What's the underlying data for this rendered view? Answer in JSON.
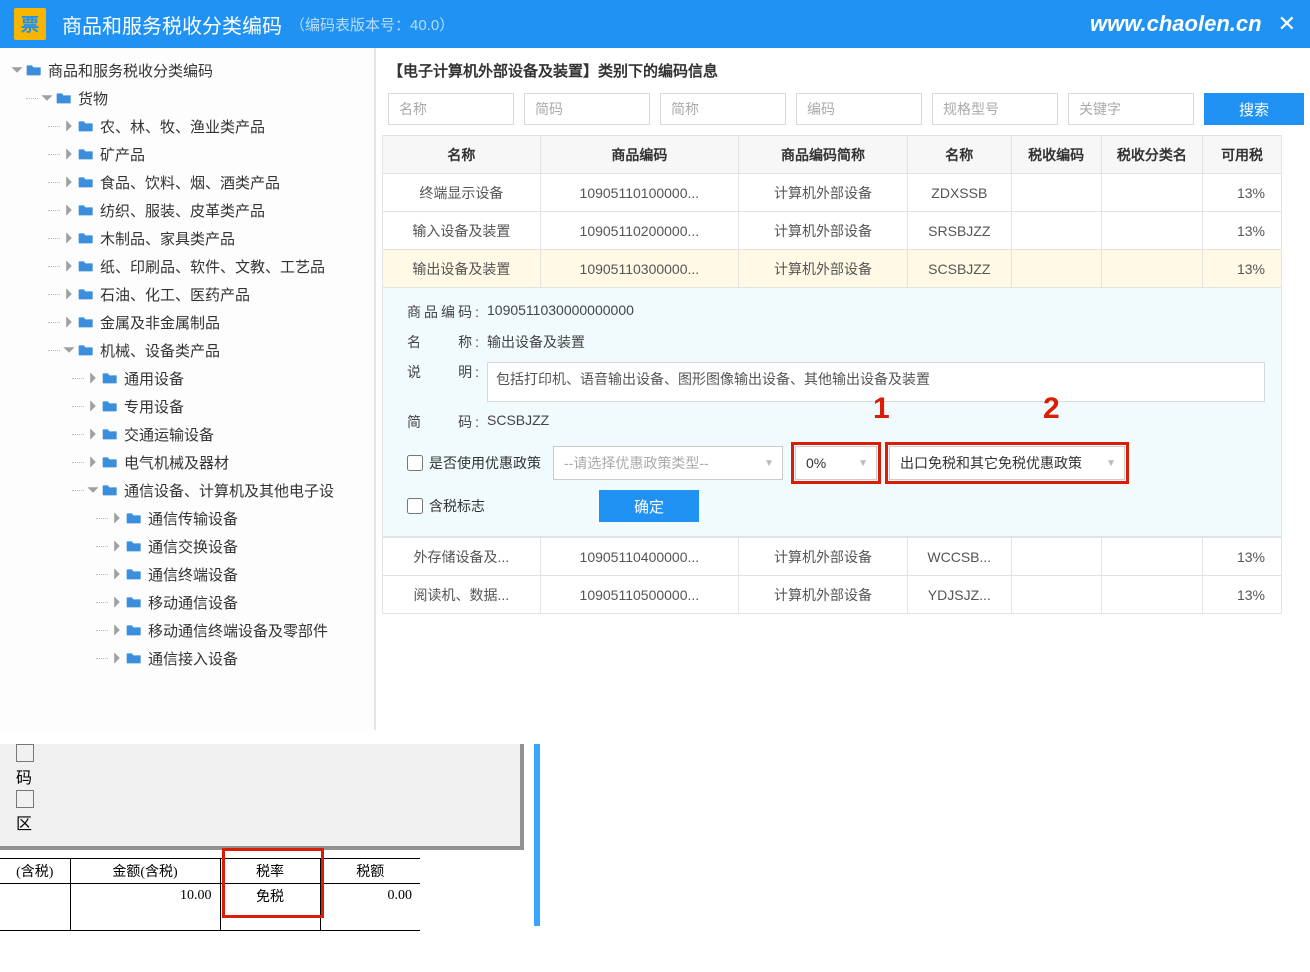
{
  "header": {
    "logo_text": "票",
    "title": "商品和服务税收分类编码",
    "version": "（编码表版本号：40.0）",
    "url": "www.chaolen.cn",
    "close": "✕"
  },
  "tree": [
    {
      "level": 0,
      "open": true,
      "label": "商品和服务税收分类编码"
    },
    {
      "level": 1,
      "open": true,
      "label": "货物"
    },
    {
      "level": 2,
      "open": false,
      "label": "农、林、牧、渔业类产品"
    },
    {
      "level": 2,
      "open": false,
      "label": "矿产品"
    },
    {
      "level": 2,
      "open": false,
      "label": "食品、饮料、烟、酒类产品"
    },
    {
      "level": 2,
      "open": false,
      "label": "纺织、服装、皮革类产品"
    },
    {
      "level": 2,
      "open": false,
      "label": "木制品、家具类产品"
    },
    {
      "level": 2,
      "open": false,
      "label": "纸、印刷品、软件、文教、工艺品"
    },
    {
      "level": 2,
      "open": false,
      "label": "石油、化工、医药产品"
    },
    {
      "level": 2,
      "open": false,
      "label": "金属及非金属制品"
    },
    {
      "level": 2,
      "open": true,
      "label": "机械、设备类产品"
    },
    {
      "level": 3,
      "open": false,
      "label": "通用设备"
    },
    {
      "level": 3,
      "open": false,
      "label": "专用设备"
    },
    {
      "level": 3,
      "open": false,
      "label": "交通运输设备"
    },
    {
      "level": 3,
      "open": false,
      "label": "电气机械及器材"
    },
    {
      "level": 3,
      "open": true,
      "label": "通信设备、计算机及其他电子设"
    },
    {
      "level": 4,
      "open": false,
      "label": "通信传输设备"
    },
    {
      "level": 4,
      "open": false,
      "label": "通信交换设备"
    },
    {
      "level": 4,
      "open": false,
      "label": "通信终端设备"
    },
    {
      "level": 4,
      "open": false,
      "label": "移动通信设备"
    },
    {
      "level": 4,
      "open": false,
      "label": "移动通信终端设备及零部件"
    },
    {
      "level": 4,
      "open": false,
      "label": "通信接入设备"
    }
  ],
  "main": {
    "title": "【电子计算机外部设备及装置】类别下的编码信息",
    "filters": {
      "ph_name": "名称",
      "ph_jm": "简码",
      "ph_jc": "简称",
      "ph_code": "编码",
      "ph_gg": "规格型号",
      "ph_kw": "关键字",
      "search": "搜索"
    },
    "columns": [
      "名称",
      "商品编码",
      "商品编码简称",
      "名称",
      "税收编码",
      "税收分类名",
      "可用税"
    ],
    "rows_top": [
      {
        "name": "终端显示设备",
        "code": "10905110100000...",
        "short": "计算机外部设备",
        "nm2": "ZDXSSB",
        "tx": "",
        "cls": "",
        "rate": "13%"
      },
      {
        "name": "输入设备及装置",
        "code": "10905110200000...",
        "short": "计算机外部设备",
        "nm2": "SRSBJZZ",
        "tx": "",
        "cls": "",
        "rate": "13%"
      },
      {
        "name": "输出设备及装置",
        "code": "10905110300000...",
        "short": "计算机外部设备",
        "nm2": "SCSBJZZ",
        "tx": "",
        "cls": "",
        "rate": "13%",
        "sel": true
      }
    ],
    "rows_bottom": [
      {
        "name": "外存储设备及...",
        "code": "10905110400000...",
        "short": "计算机外部设备",
        "nm2": "WCCSB...",
        "tx": "",
        "cls": "",
        "rate": "13%"
      },
      {
        "name": "阅读机、数据...",
        "code": "10905110500000...",
        "short": "计算机外部设备",
        "nm2": "YDJSJZ...",
        "tx": "",
        "cls": "",
        "rate": "13%"
      }
    ],
    "detail": {
      "code_label": "商品编码:",
      "code": "1090511030000000000",
      "name_label": "名　　称:",
      "name": "输出设备及装置",
      "desc_label": "说　　明:",
      "desc": "包括打印机、语音输出设备、图形图像输出设备、其他输出设备及装置",
      "jm_label": "简　　码:",
      "jm": "SCSBJZZ",
      "chk_policy": "是否使用优惠政策",
      "sel_policy_ph": "--请选择优惠政策类型--",
      "sel_rate": "0%",
      "sel_exempt": "出口免税和其它免税优惠政策",
      "chk_tax": "含税标志",
      "btn_ok": "确定"
    },
    "annotations": {
      "one": "1",
      "two": "2"
    }
  },
  "fragment": {
    "glyphs": [
      "码",
      "区"
    ],
    "head_left": "(含税)",
    "headers": [
      "金额(含税)",
      "税率",
      "税额"
    ],
    "row": {
      "amount": "10.00",
      "rate": "免税",
      "tax": "0.00"
    }
  }
}
